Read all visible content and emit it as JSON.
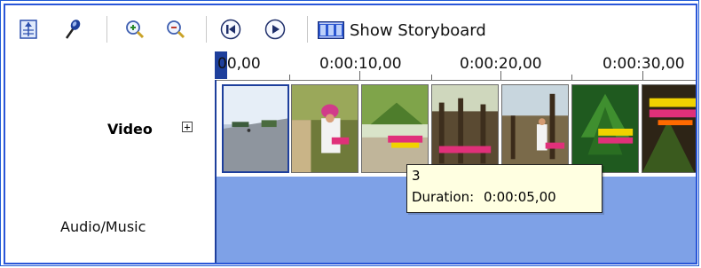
{
  "toolbar": {
    "show_storyboard_label": "Show Storyboard",
    "buttons": [
      {
        "name": "set-audio-levels-button",
        "icon": "audio-levels-icon"
      },
      {
        "name": "narrate-timeline-button",
        "icon": "microphone-icon"
      },
      {
        "name": "zoom-in-button",
        "icon": "zoom-in-icon"
      },
      {
        "name": "zoom-out-button",
        "icon": "zoom-out-icon"
      },
      {
        "name": "rewind-button",
        "icon": "skip-back-icon"
      },
      {
        "name": "play-button",
        "icon": "play-icon"
      },
      {
        "name": "show-storyboard-button",
        "icon": "film-strip-icon"
      }
    ]
  },
  "tracks": {
    "video_label": "Video",
    "expand_symbol": "+",
    "audio_label": "Audio/Music"
  },
  "ruler": {
    "labels": [
      "00,00",
      "0:00:10,00",
      "0:00:20,00",
      "0:00:30,00"
    ]
  },
  "clips": [
    {
      "name": "clip-1",
      "selected": true,
      "overlay_text": ""
    },
    {
      "name": "clip-2",
      "selected": false,
      "overlay_text": ""
    },
    {
      "name": "clip-3",
      "selected": false,
      "overlay_text": ""
    },
    {
      "name": "clip-4",
      "selected": false,
      "overlay_text": ""
    },
    {
      "name": "clip-5",
      "selected": false,
      "overlay_text": ""
    },
    {
      "name": "clip-6",
      "selected": false,
      "overlay_text": ""
    },
    {
      "name": "clip-7",
      "selected": false,
      "overlay_text": ""
    }
  ],
  "tooltip": {
    "title": "3",
    "duration_label": "Duration:",
    "duration_value": "0:00:05,00"
  },
  "colors": {
    "accent": "#2a57d8",
    "audio_track": "#7ea1e7",
    "playhead": "#1e3f9c",
    "tooltip_bg": "#ffffe1"
  }
}
